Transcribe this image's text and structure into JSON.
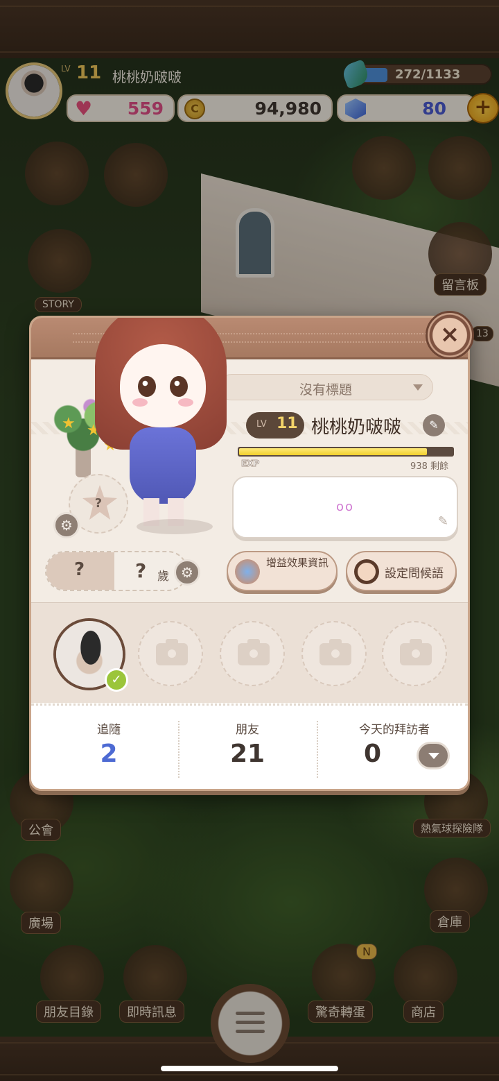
{
  "hud": {
    "level_prefix": "LV",
    "level": "11",
    "player_name": "桃桃奶啵啵",
    "exp_display": "272/1133",
    "exp_fraction": 0.24,
    "hearts": "559",
    "coins": "94,980",
    "gems": "80",
    "plus_label": "+"
  },
  "side_menu": {
    "story": "STORY",
    "message_board": "留言板",
    "guild": "公會",
    "plaza": "廣場",
    "balloon_team": "熱氣球探險隊",
    "warehouse": "倉庫",
    "badge_13": "13",
    "badge_n": "N"
  },
  "bottom_bar": {
    "friends_list": "朋友目錄",
    "instant_message": "即時訊息",
    "surprise_gacha": "驚奇轉蛋",
    "shop": "商店"
  },
  "profile": {
    "close_label": "×",
    "title_dropdown": "沒有標題",
    "level_prefix": "LV",
    "level": "11",
    "name": "桃桃奶啵啵",
    "exp_label": "EXP",
    "exp_remaining": "938 剩餘",
    "exp_fill_fraction": 0.88,
    "greeting_text": "oo",
    "buff_info_button": "增益效果資訊",
    "set_greeting_button": "設定問候語",
    "age_question": "?",
    "age_value": "?",
    "age_unit": "歲",
    "flower_question": "?"
  },
  "stats": {
    "following_label": "追隨",
    "following_value": "2",
    "friends_label": "朋友",
    "friends_value": "21",
    "visitors_label": "今天的拜訪者",
    "visitors_value": "0"
  },
  "colors": {
    "following_blue": "#4d6ad3",
    "stat_dark": "#3f3530",
    "coin_text": "#3f3530",
    "heart_text": "#e14f87",
    "gem_text": "#4a5ad0"
  }
}
